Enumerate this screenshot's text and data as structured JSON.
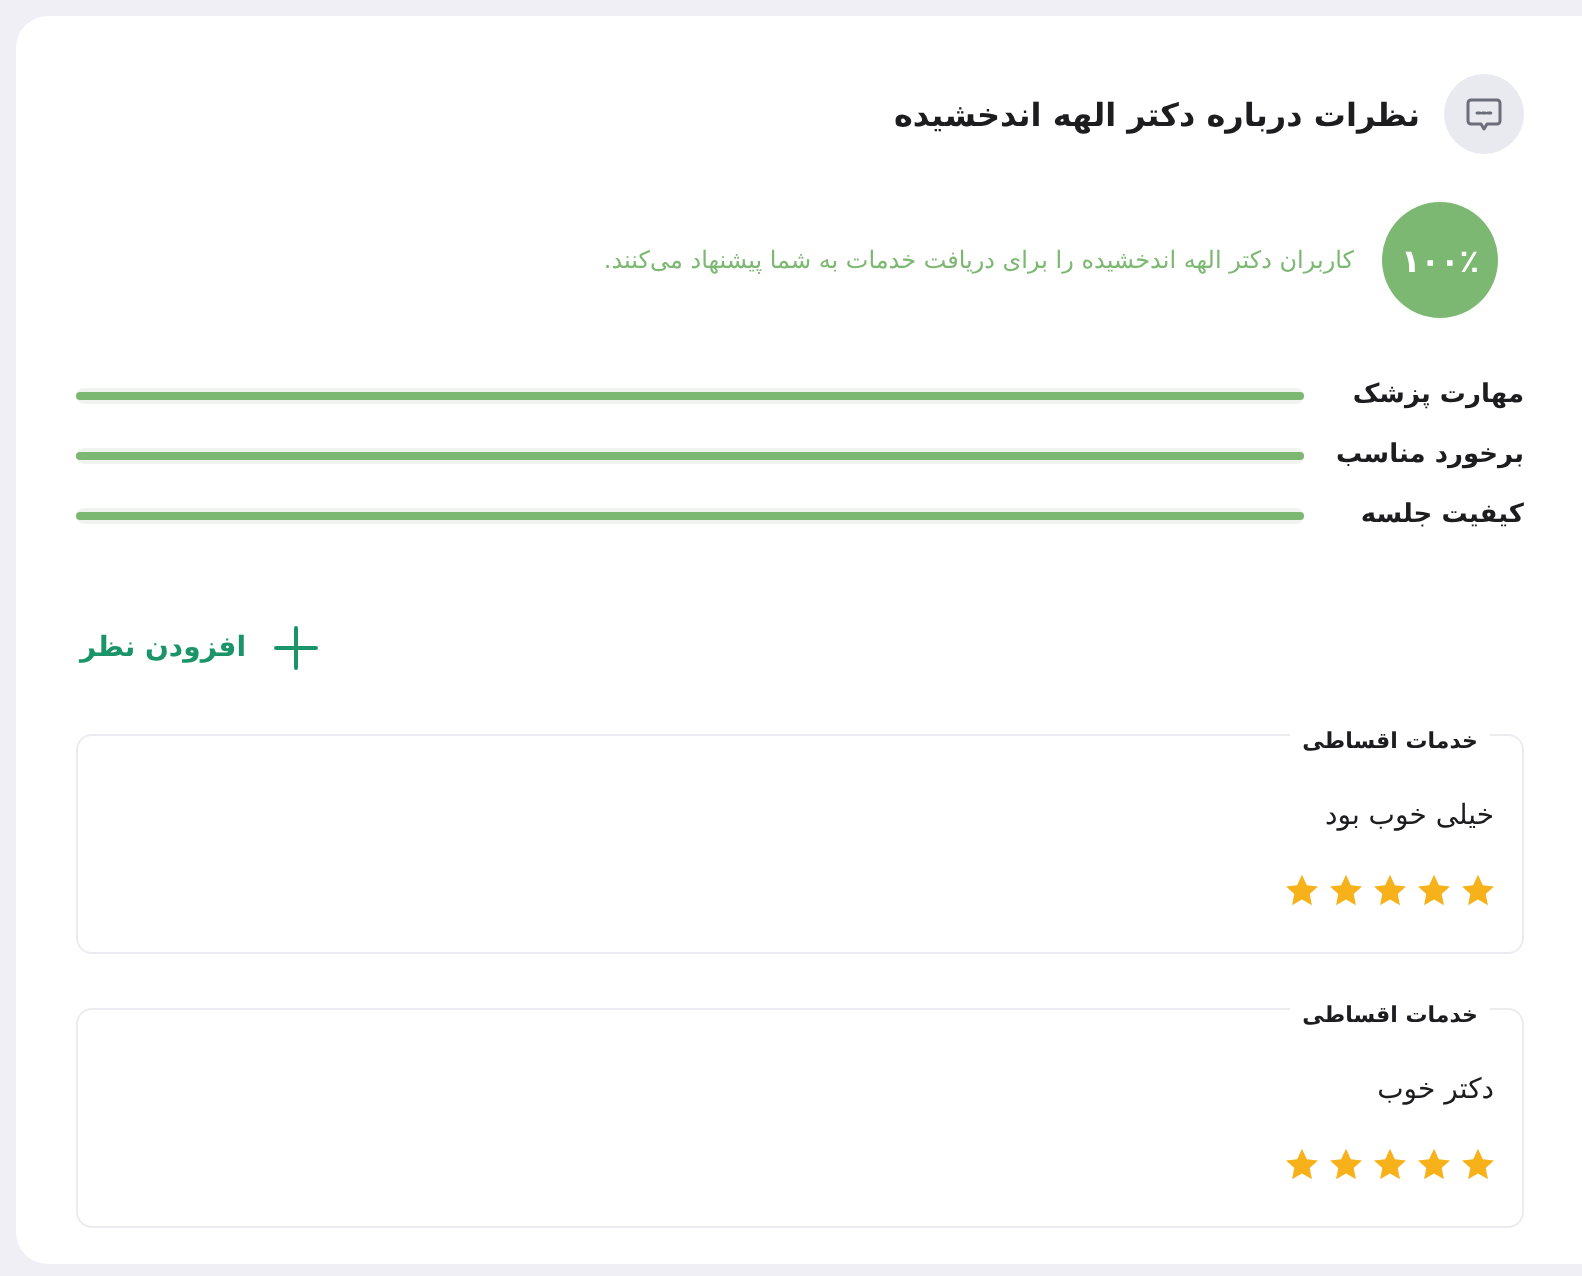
{
  "header": {
    "title": "نظرات درباره دکتر الهه اندخشیده"
  },
  "recommendation": {
    "percent": "۱۰۰٪",
    "text": "کاربران دکتر الهه اندخشیده را برای دریافت خدمات به شما پیشنهاد می‌کنند."
  },
  "ratings": [
    {
      "label": "مهارت پزشک",
      "level": 1
    },
    {
      "label": "برخورد مناسب",
      "level": 1
    },
    {
      "label": "کیفیت جلسه",
      "level": 1
    }
  ],
  "add_comment": {
    "label": "افزودن نظر"
  },
  "reviews": [
    {
      "tag": "خدمات اقساطی",
      "text": "خیلی خوب بود",
      "stars": 5
    },
    {
      "tag": "خدمات اقساطی",
      "text": "دکتر خوب",
      "stars": 5
    }
  ]
}
